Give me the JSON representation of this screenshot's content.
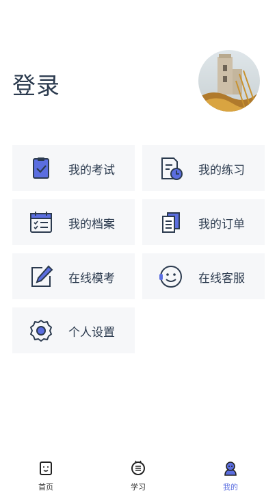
{
  "header": {
    "title": "登录"
  },
  "menu": [
    {
      "label": "我的考试",
      "icon": "exam-icon"
    },
    {
      "label": "我的练习",
      "icon": "practice-icon"
    },
    {
      "label": "我的档案",
      "icon": "calendar-icon"
    },
    {
      "label": "我的订单",
      "icon": "order-icon"
    },
    {
      "label": "在线模考",
      "icon": "edit-icon"
    },
    {
      "label": "在线客服",
      "icon": "support-icon"
    },
    {
      "label": "个人设置",
      "icon": "gear-icon"
    }
  ],
  "tabbar": {
    "items": [
      {
        "label": "首页",
        "icon": "home-icon"
      },
      {
        "label": "学习",
        "icon": "study-icon"
      },
      {
        "label": "我的",
        "icon": "profile-icon"
      }
    ],
    "active_index": 2
  },
  "colors": {
    "accent": "#5b6ee0",
    "tile_bg": "#f6f7f9",
    "text": "#2b3a4e"
  }
}
